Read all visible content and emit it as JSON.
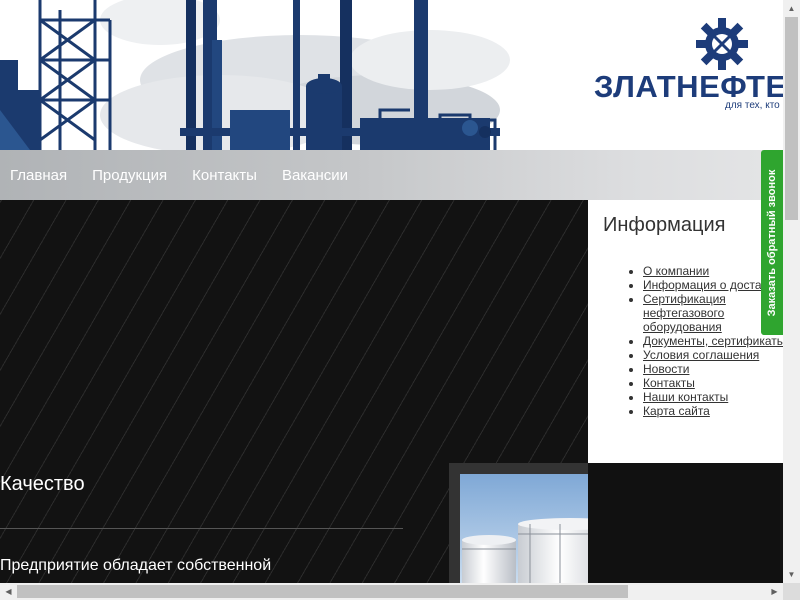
{
  "header": {
    "brand": "ЗЛАТНЕФТЕ",
    "tagline": "для тех, кто",
    "logo_icon": "gear-wrench-icon",
    "brand_color": "#1d3c7a"
  },
  "nav": {
    "items": [
      "Главная",
      "Продукция",
      "Контакты",
      "Вакансии"
    ]
  },
  "sidebar": {
    "title": "Информация",
    "links": [
      "О компании",
      "Информация о доста",
      "Сертификация нефтегазового оборудования",
      "Документы, сертификаты",
      "Условия соглашения",
      "Новости",
      "Контакты",
      "Наши контакты",
      "Карта сайта"
    ]
  },
  "main": {
    "section_title": "Качество",
    "section_text": "Предприятие обладает собственной"
  },
  "callback": {
    "label": "Заказать обратный звонок",
    "color": "#2fa52f"
  },
  "scrollbars": {
    "up_icon": "arrow-up-icon",
    "down_icon": "arrow-down-icon",
    "left_icon": "arrow-left-icon",
    "right_icon": "arrow-right-icon"
  }
}
